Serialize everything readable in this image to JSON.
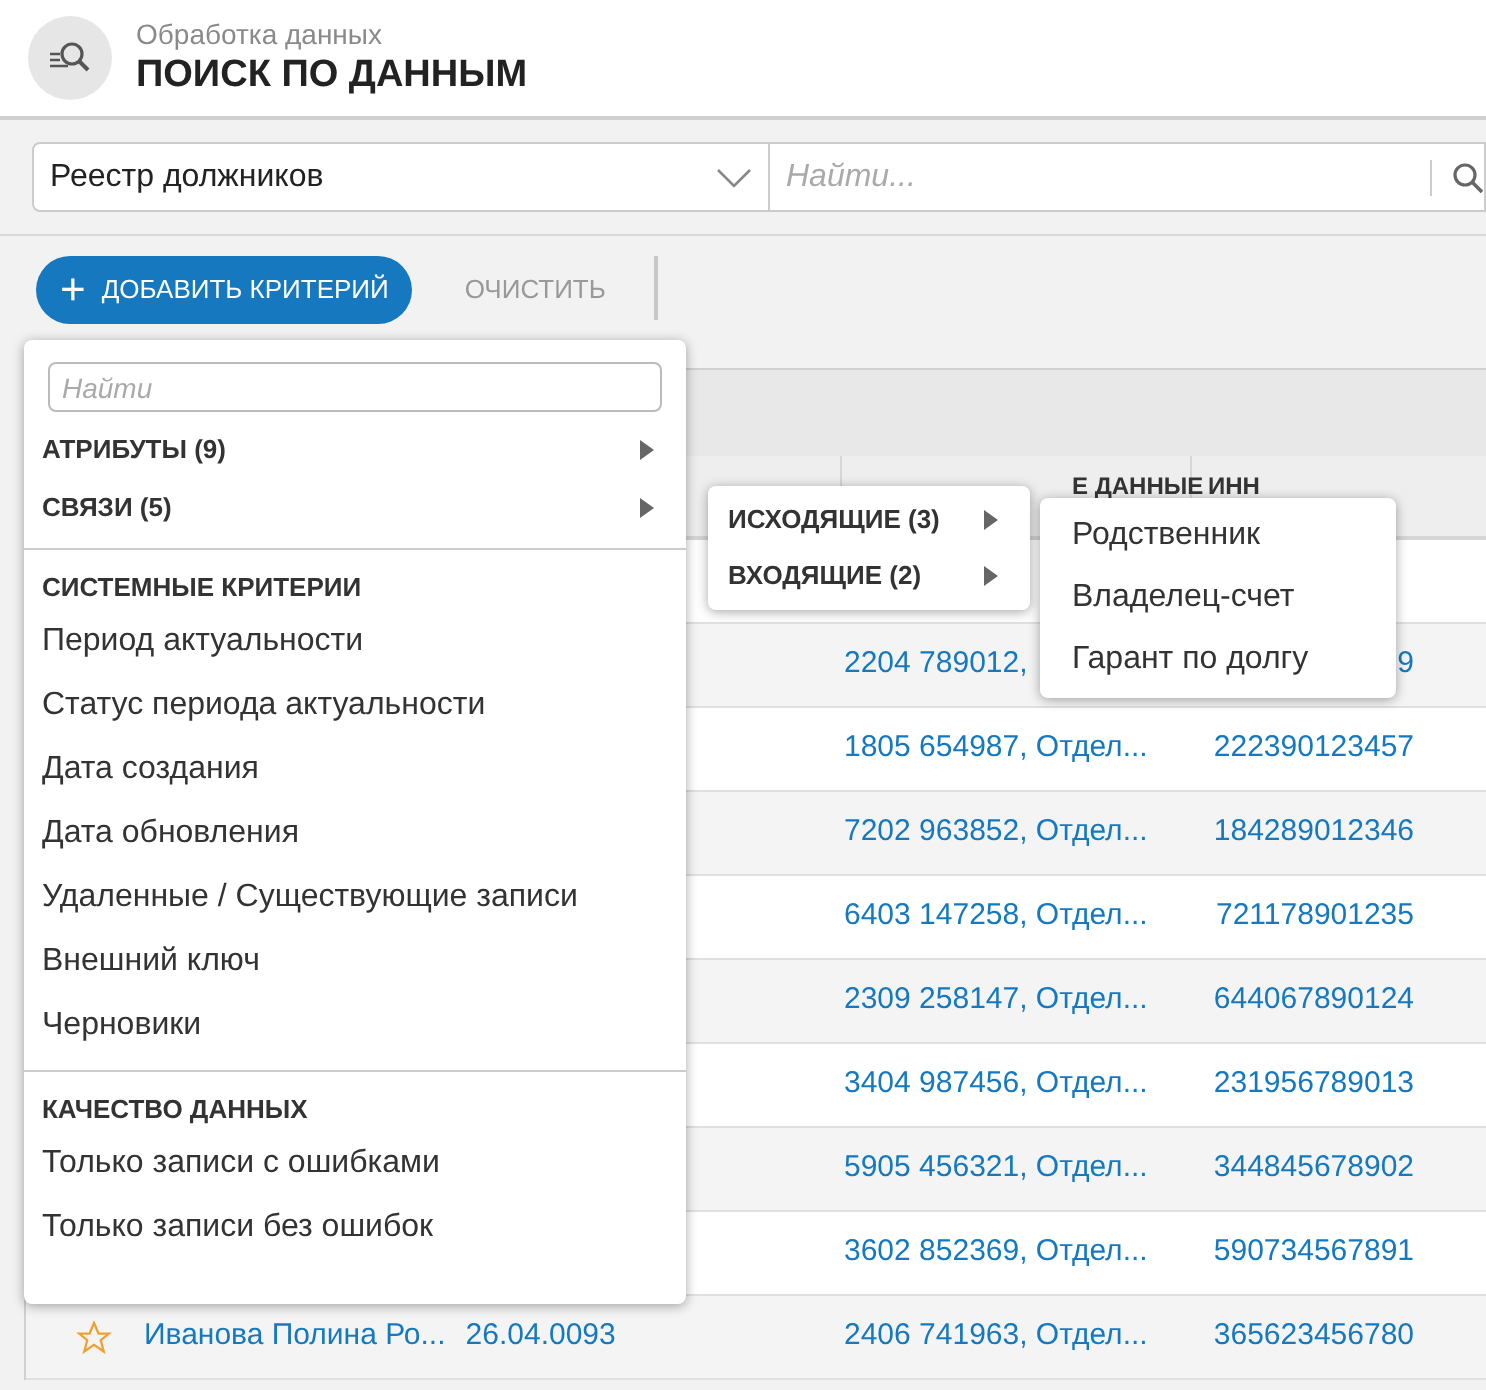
{
  "header": {
    "subtitle": "Обработка данных",
    "title": "ПОИСК ПО ДАННЫМ"
  },
  "toolbar": {
    "registry": "Реестр должников",
    "search_placeholder": "Найти..."
  },
  "actions": {
    "add_button": "ДОБАВИТЬ КРИТЕРИЙ",
    "add_icon": "+",
    "clear_button": "ОЧИСТИТЬ"
  },
  "table": {
    "columns": [
      {},
      {
        "label": "Е ДАННЫЕ"
      },
      {
        "label": "ИНН"
      }
    ],
    "rows": [
      {},
      {
        "passport": "2204 789012,",
        "inn": "9"
      },
      {
        "passport": "1805 654987, Отдел...",
        "inn": "222390123457"
      },
      {
        "passport": "7202 963852, Отдел...",
        "inn": "184289012346"
      },
      {
        "passport": "6403 147258, Отдел...",
        "inn": "721178901235"
      },
      {
        "passport": "2309 258147, Отдел...",
        "inn": "644067890124"
      },
      {
        "passport": "3404 987456, Отдел...",
        "inn": "231956789013"
      },
      {
        "passport": "5905 456321, Отдел...",
        "inn": "344845678902"
      },
      {
        "passport": "3602 852369, Отдел...",
        "inn": "590734567891"
      },
      {
        "favorite": false,
        "name": "Иванова Полина Ро...",
        "date": "26.04.0093",
        "passport": "2406 741963, Отдел...",
        "inn": "365623456780"
      }
    ]
  },
  "criteria_menu": {
    "search_placeholder": "Найти",
    "sections": [
      {
        "items": [
          {
            "label": "АТРИБУТЫ (9)",
            "kind": "submenu"
          },
          {
            "label": "СВЯЗИ (5)",
            "kind": "submenu"
          }
        ]
      },
      {
        "title": "СИСТЕМНЫЕ КРИТЕРИИ",
        "items": [
          {
            "label": "Период актуальности",
            "kind": "option"
          },
          {
            "label": "Статус периода актуальности",
            "kind": "option"
          },
          {
            "label": "Дата создания",
            "kind": "option"
          },
          {
            "label": "Дата обновления",
            "kind": "option"
          },
          {
            "label": "Удаленные / Существующие записи",
            "kind": "option"
          },
          {
            "label": "Внешний ключ",
            "kind": "option"
          },
          {
            "label": "Черновики",
            "kind": "option"
          }
        ]
      },
      {
        "title": "КАЧЕСТВО ДАННЫХ",
        "items": [
          {
            "label": "Только записи с ошибками",
            "kind": "option"
          },
          {
            "label": "Только записи без ошибок",
            "kind": "option"
          }
        ]
      }
    ]
  },
  "links_menu": {
    "items": [
      {
        "label": "ИСХОДЯЩИЕ (3)",
        "kind": "submenu"
      },
      {
        "label": "ВХОДЯЩИЕ (2)",
        "kind": "submenu"
      }
    ]
  },
  "outgoing_menu": {
    "items": [
      {
        "label": "Родственник",
        "kind": "option"
      },
      {
        "label": "Владелец-счет",
        "kind": "option"
      },
      {
        "label": "Гарант по долгу",
        "kind": "option"
      }
    ]
  }
}
